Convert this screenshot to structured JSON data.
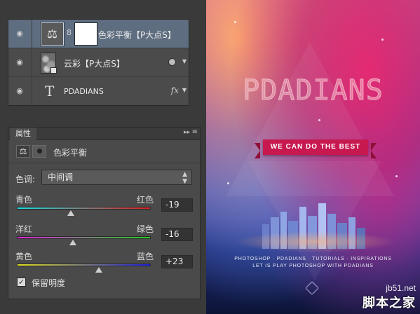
{
  "layers": {
    "items": [
      {
        "name": "色彩平衡【P大点S】",
        "type": "adjustment",
        "selected": true
      },
      {
        "name": "云彩【P大点S】",
        "type": "smart-object",
        "selected": false
      },
      {
        "name": "PDADIANS",
        "type": "text",
        "selected": false,
        "fx": "fx"
      }
    ]
  },
  "properties": {
    "tab_label": "属性",
    "title": "色彩平衡",
    "tone_label": "色调:",
    "tone_value": "中间调",
    "sliders": [
      {
        "left": "青色",
        "right": "红色",
        "value": "-19",
        "level": -19,
        "colors": [
          "#19e0e0",
          "#e02020"
        ]
      },
      {
        "left": "洋红",
        "right": "绿色",
        "value": "-16",
        "level": -16,
        "colors": [
          "#e020e0",
          "#20d020"
        ]
      },
      {
        "left": "黄色",
        "right": "蓝色",
        "value": "+23",
        "level": 23,
        "colors": [
          "#e0e020",
          "#2020e0"
        ]
      }
    ],
    "preserve_luminosity": {
      "label": "保留明度",
      "checked": true
    }
  },
  "poster": {
    "title": "PDADIANS",
    "ribbon": "WE CAN DO THE BEST",
    "tagline1": "PHOTOSHOP · PDADIANS · TUTORIALS · INSPIRATIONS",
    "tagline2": "LET IS PLAY PHOTOSHOP WITH PDADIANS"
  },
  "watermark": {
    "url": "jb51.net",
    "name": "脚本之家"
  }
}
